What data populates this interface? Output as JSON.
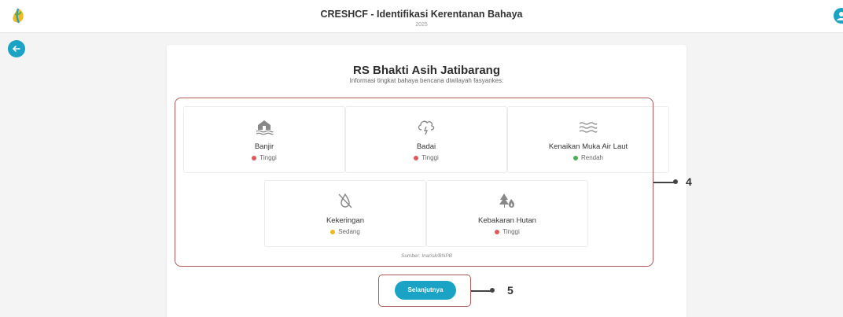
{
  "header": {
    "title": "CRESHCF - Identifikasi Kerentanan Bahaya",
    "year": "2025"
  },
  "colors": {
    "accent": "#1aa3c4",
    "high": "#e05a5a",
    "medium": "#f2b721",
    "low": "#4caf50",
    "annotation": "#b05a5a"
  },
  "hospital": {
    "name": "RS Bhakti Asih Jatibarang",
    "subtitle": "Informasi tingkat bahaya bencana diwilayah fasyankes:"
  },
  "hazards": [
    {
      "name": "Banjir",
      "level": "Tinggi",
      "icon": "house-flood-icon",
      "level_color": "#e05a5a"
    },
    {
      "name": "Badai",
      "level": "Tinggi",
      "icon": "cloud-storm-icon",
      "level_color": "#e05a5a"
    },
    {
      "name": "Kenaikan Muka Air Laut",
      "level": "Rendah",
      "icon": "waves-icon",
      "level_color": "#4caf50"
    },
    {
      "name": "Kekeringan",
      "level": "Sedang",
      "icon": "no-water-drop-icon",
      "level_color": "#f2b721"
    },
    {
      "name": "Kebakaran Hutan",
      "level": "Tinggi",
      "icon": "forest-fire-icon",
      "level_color": "#e05a5a"
    }
  ],
  "source": "Sumber: Inarisk/BNPB",
  "next_button": "Selanjutnya",
  "annotations": {
    "hazard_panel": "4",
    "next": "5"
  }
}
